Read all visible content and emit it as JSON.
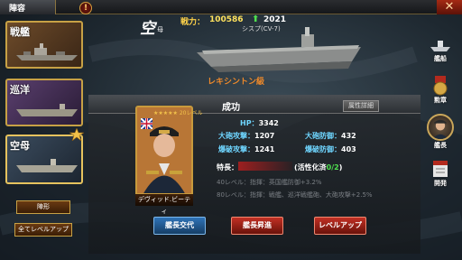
{
  "header": {
    "title": "陣容",
    "info_icon": "info-icon",
    "close_icon": "close-x-icon"
  },
  "left_list": {
    "cards": [
      {
        "type_kanji": "戦艦"
      },
      {
        "type_kanji": "巡洋"
      },
      {
        "type_kanji": "空母"
      }
    ],
    "formation_button": "陣形",
    "all_level_up_button": "全てレベルアップ"
  },
  "sidebar": {
    "items": [
      {
        "label": "艦船",
        "icon": "ship-icon"
      },
      {
        "label": "勲章",
        "icon": "medal-icon"
      },
      {
        "label": "艦長",
        "icon": "captain-icon"
      },
      {
        "label": "開発",
        "icon": "dev-icon"
      }
    ]
  },
  "ship": {
    "type_kanji": "空",
    "type_kanji_small": "母",
    "power_label": "戦力：",
    "power_value": "100586",
    "power_gain": "2021",
    "subname": "シスプ(CV-7)",
    "class_name": "レキシントン級"
  },
  "panel": {
    "title": "成功",
    "detail_button": "属性詳細",
    "captain_name": "デヴィッド.ビーティ",
    "captain_level_text": "20レベル",
    "stats": {
      "hp_label": "HP：",
      "hp_value": "3342",
      "main_atk_label": "大砲攻撃：",
      "main_atk_value": "1207",
      "main_def_label": "大砲防御：",
      "main_def_value": "432",
      "bomb_atk_label": "爆破攻撃：",
      "bomb_atk_value": "1241",
      "bomb_def_label": "爆破防御：",
      "bomb_def_value": "403"
    },
    "trait_label": "特長：",
    "trait_activation_label": "(活性化済",
    "trait_activation_value": "0/2",
    "trait_activation_close": ")",
    "trait_lines": [
      "40レベル：指揮：英国艦防御+3.2%",
      "80レベル：指揮：戦艦、巡洋戦艦砲、大砲攻撃+2.5%"
    ]
  },
  "buttons": {
    "swap_captain": "艦長交代",
    "promote_captain": "艦長昇進",
    "level_up": "レベルアップ"
  },
  "colors": {
    "gold_border": "#c7a145",
    "power_yellow": "#ffe25e",
    "stat_key_blue": "#6fd6ff",
    "class_orange": "#f08a2a",
    "button_blue": "#2f73b8",
    "button_red": "#c23024"
  }
}
